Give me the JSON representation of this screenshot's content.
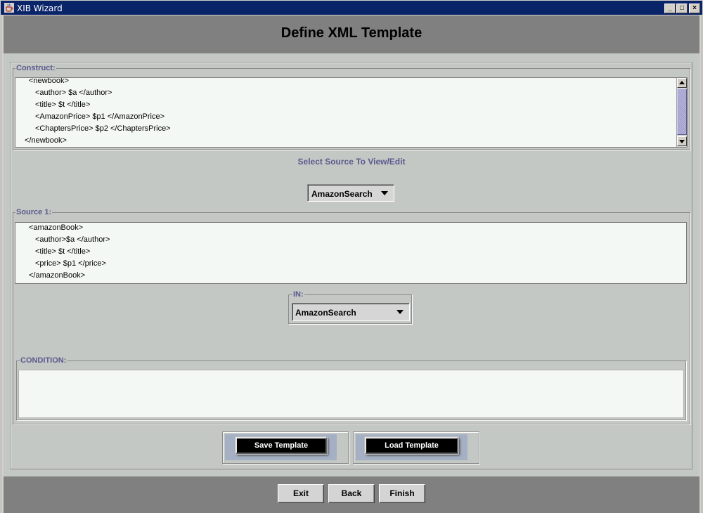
{
  "window": {
    "title": "XIB Wizard",
    "minimize_glyph": "_",
    "maximize_glyph": "□",
    "close_glyph": "×"
  },
  "page_title": "Define XML Template",
  "construct": {
    "legend": "Construct:",
    "lines": [
      "<newbook>",
      "<author> $a </author>",
      "<title> $t </title>",
      "<AmazonPrice> $p1 </AmazonPrice>",
      "<ChaptersPrice> $p2 </ChaptersPrice>",
      "</newbook>"
    ]
  },
  "select_source": {
    "label": "Select Source To View/Edit",
    "selected": "AmazonSearch"
  },
  "source": {
    "legend": "Source 1:",
    "lines": [
      "<amazonBook>",
      "<author>$a </author>",
      "<title> $t </title>",
      "<price> $p1 </price>",
      "</amazonBook>"
    ]
  },
  "in": {
    "legend": "IN:",
    "selected": "AmazonSearch"
  },
  "condition": {
    "legend": "CONDITION:",
    "value": ""
  },
  "template_buttons": {
    "save": "Save Template",
    "load": "Load Template"
  },
  "nav": {
    "exit": "Exit",
    "back": "Back",
    "finish": "Finish"
  },
  "colors": {
    "title_bar": "#0a246a",
    "legend_text": "#5a5a8e",
    "scroll_thumb": "#9c9cc8"
  }
}
